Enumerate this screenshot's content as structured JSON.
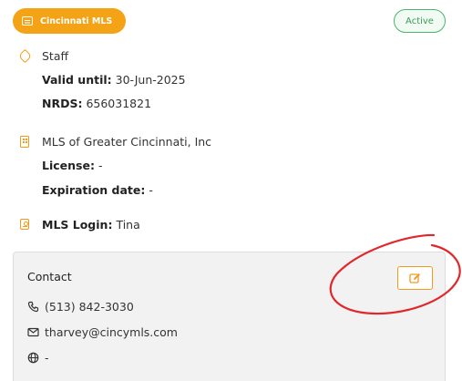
{
  "membership": {
    "badge_label": "Cincinnati MLS",
    "status": "Active"
  },
  "role": {
    "title": "Staff",
    "valid_until_label": "Valid until:",
    "valid_until_value": "30-Jun-2025",
    "nrds_label": "NRDS:",
    "nrds_value": "656031821"
  },
  "organization": {
    "name": "MLS of Greater Cincinnati, Inc",
    "license_label": "License:",
    "license_value": "-",
    "expiration_label": "Expiration date:",
    "expiration_value": "-"
  },
  "login": {
    "label": "MLS Login:",
    "value": "Tina"
  },
  "contact": {
    "title": "Contact",
    "phone": "(513) 842-3030",
    "email": "tharvey@cincymls.com",
    "website": "-"
  },
  "colors": {
    "accent": "#f5a316",
    "status_green": "#4bb56c",
    "annotation_red": "#e0282c"
  },
  "icons": [
    "card-icon",
    "tag-icon",
    "building-icon",
    "id-card-icon",
    "edit-icon",
    "phone-icon",
    "mail-icon",
    "globe-icon"
  ]
}
